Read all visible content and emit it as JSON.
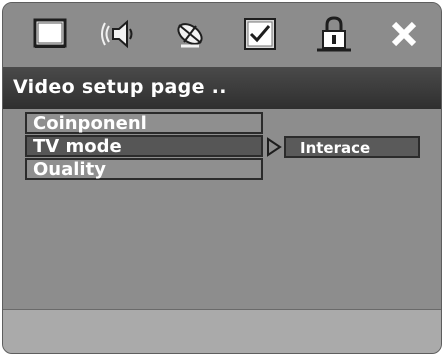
{
  "toolbar": {
    "icons": [
      "tv-icon",
      "speaker-icon",
      "satellite-icon",
      "checkbox-icon",
      "lock-icon",
      "close-icon"
    ]
  },
  "page": {
    "title": "Video setup page .."
  },
  "menu": {
    "items": [
      {
        "label": "Coinponenl"
      },
      {
        "label": "TV mode"
      },
      {
        "label": "Ouality"
      }
    ],
    "selected_index": 1
  },
  "submenu": {
    "value": "Interace"
  },
  "colors": {
    "background": "#8c8c8c",
    "title_bar": "#3a3a3a",
    "selected_row": "#565656",
    "text": "#ffffff"
  }
}
